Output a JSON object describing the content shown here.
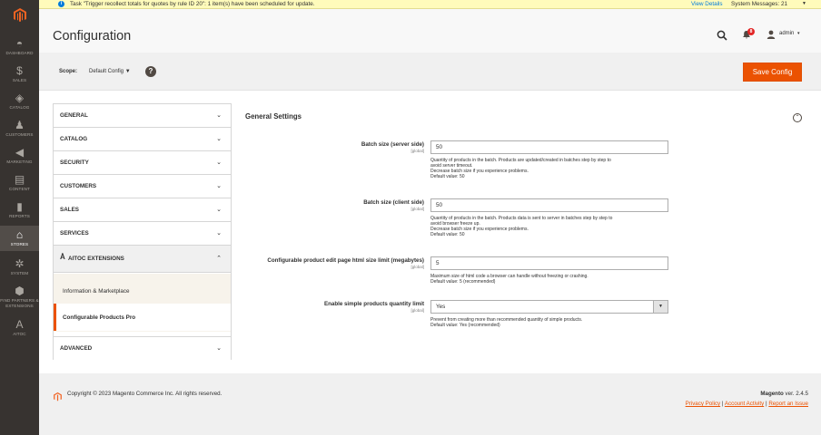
{
  "sidebar": {
    "items": [
      {
        "label": "DASHBOARD",
        "icon": "dashboard-icon",
        "glyph": "◓"
      },
      {
        "label": "SALES",
        "icon": "dollar-icon",
        "glyph": "$"
      },
      {
        "label": "CATALOG",
        "icon": "cube-icon",
        "glyph": "◈"
      },
      {
        "label": "CUSTOMERS",
        "icon": "person-icon",
        "glyph": "♟"
      },
      {
        "label": "MARKETING",
        "icon": "megaphone-icon",
        "glyph": "◀"
      },
      {
        "label": "CONTENT",
        "icon": "layout-icon",
        "glyph": "▤"
      },
      {
        "label": "REPORTS",
        "icon": "bar-chart-icon",
        "glyph": "▮"
      },
      {
        "label": "STORES",
        "icon": "store-icon",
        "glyph": "⌂"
      },
      {
        "label": "SYSTEM",
        "icon": "gear-icon",
        "glyph": "✲"
      },
      {
        "label": "FIND PARTNERS & EXTENSIONS",
        "icon": "puzzle-icon",
        "glyph": "⬢"
      },
      {
        "label": "AITOC",
        "icon": "aitoc-icon",
        "glyph": "A"
      }
    ],
    "active_index": 7
  },
  "message": {
    "text": "Task \"Trigger recollect totals for quotes by rule ID 20\": 1 item(s) have been scheduled for update.",
    "details_link": "View Details",
    "system_messages": "System Messages: 21"
  },
  "header": {
    "title": "Configuration",
    "notification_count": "8",
    "user": "admin"
  },
  "scope": {
    "label": "Scope:",
    "value": "Default Config",
    "help": "?",
    "save_label": "Save Config"
  },
  "tabs": {
    "items": [
      {
        "label": "GENERAL"
      },
      {
        "label": "CATALOG"
      },
      {
        "label": "SECURITY"
      },
      {
        "label": "CUSTOMERS"
      },
      {
        "label": "SALES"
      },
      {
        "label": "SERVICES"
      }
    ],
    "aitoc": "AITOC EXTENSIONS",
    "subitems": [
      "Information & Marketplace",
      "Configurable Products Pro"
    ],
    "advanced": "ADVANCED"
  },
  "section": {
    "title": "General Settings",
    "fields": [
      {
        "label": "Batch size (server side)",
        "scope": "[global]",
        "value": "50",
        "note1": "Quantity of products in the batch. Products are updated/created in batches step by step to",
        "note2": "avoid server timeout.",
        "note3": "Decrease batch size if you experience problems.",
        "note4": "Default value: 50"
      },
      {
        "label": "Batch size (client side)",
        "scope": "[global]",
        "value": "50",
        "note1": "Quantity of products in the batch. Products data is sent to server in batches step by step to",
        "note2": "avoid browser freeze up.",
        "note3": "Decrease batch size if you experience problems.",
        "note4": "Default value: 50"
      },
      {
        "label": "Configurable product edit page html size limit (megabytes)",
        "scope": "[global]",
        "value": "5",
        "note1": "Maximum size of html code a browser can handle without freezing or crashing.",
        "note2": "Default value: 5 (recommended)"
      },
      {
        "label": "Enable simple products quantity limit",
        "scope": "[global]",
        "value": "Yes",
        "note1": "Prevent from creating more than recommended quantity of simple products.",
        "note2": "Default value: Yes (recommended)"
      }
    ]
  },
  "footer": {
    "copyright": "Copyright © 2023 Magento Commerce Inc. All rights reserved.",
    "brand": "Magento",
    "version": "ver. 2.4.5",
    "privacy": "Privacy Policy",
    "activity": "Account Activity",
    "report": "Report an Issue",
    "sep": "|"
  },
  "colors": {
    "accent": "#eb5202",
    "sidebar": "#373330",
    "link": "#007bdb"
  }
}
